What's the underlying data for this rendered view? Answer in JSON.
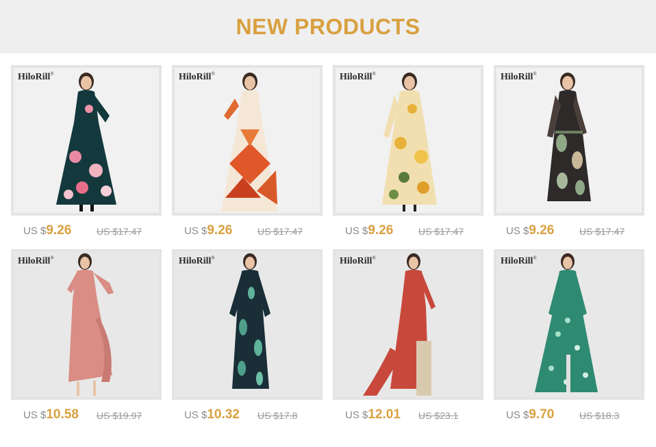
{
  "header": {
    "title": "NEW PRODUCTS"
  },
  "brand": {
    "name": "HiloRill",
    "mark": "®"
  },
  "colors": {
    "accent": "#d9a040",
    "header_bg": "#efeff0"
  },
  "products": [
    {
      "currency": "US $",
      "price": "9.26",
      "old_price": "US $17.47",
      "dress": "floral-black-wrap-dress"
    },
    {
      "currency": "US $",
      "price": "9.26",
      "old_price": "US $17.47",
      "dress": "orange-geometric-maxi-dress"
    },
    {
      "currency": "US $",
      "price": "9.26",
      "old_price": "US $17.47",
      "dress": "yellow-floral-shirt-dress"
    },
    {
      "currency": "US $",
      "price": "9.26",
      "old_price": "US $17.47",
      "dress": "paisley-long-sleeve-dress"
    },
    {
      "currency": "US $",
      "price": "10.58",
      "old_price": "US $19.97",
      "dress": "pink-ruffle-wrap-dress"
    },
    {
      "currency": "US $",
      "price": "10.32",
      "old_price": "US $17.8",
      "dress": "navy-leaf-print-dress"
    },
    {
      "currency": "US $",
      "price": "12.01",
      "old_price": "US $23.1",
      "dress": "red-dot-ruffle-dress"
    },
    {
      "currency": "US $",
      "price": "9.70",
      "old_price": "US $18.3",
      "dress": "green-floral-button-dress"
    }
  ]
}
